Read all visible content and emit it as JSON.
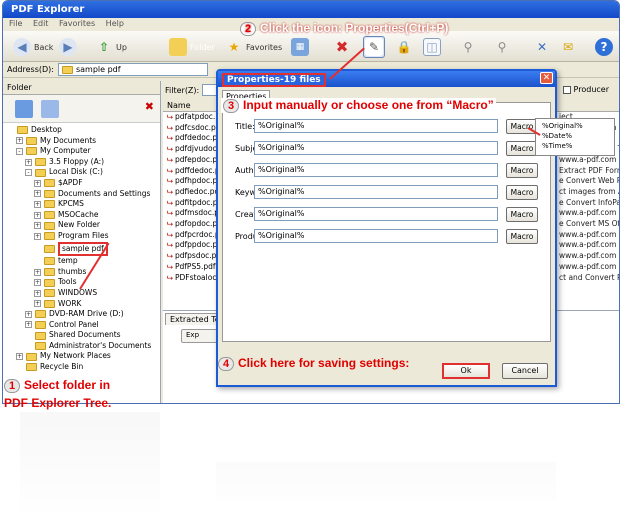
{
  "window": {
    "title": "PDF Explorer",
    "menu": [
      "File",
      "Edit",
      "Favorites",
      "Help"
    ]
  },
  "toolbar": {
    "back": "Back",
    "up": "Up",
    "folder": "Folder",
    "favorites": "Favorites"
  },
  "address": {
    "label": "Address(D):",
    "value": "sample pdf"
  },
  "left_pane": {
    "tab": "Folder",
    "tree": [
      {
        "label": "Desktop",
        "indent": 0,
        "expander": ""
      },
      {
        "label": "My Documents",
        "indent": 1,
        "expander": "+"
      },
      {
        "label": "My Computer",
        "indent": 1,
        "expander": "-"
      },
      {
        "label": "3.5 Floppy (A:)",
        "indent": 2,
        "expander": "+"
      },
      {
        "label": "Local Disk (C:)",
        "indent": 2,
        "expander": "-"
      },
      {
        "label": "$APDF",
        "indent": 3,
        "expander": "+"
      },
      {
        "label": "Documents and Settings",
        "indent": 3,
        "expander": "+"
      },
      {
        "label": "KPCMS",
        "indent": 3,
        "expander": "+"
      },
      {
        "label": "MSOCache",
        "indent": 3,
        "expander": "+"
      },
      {
        "label": "New Folder",
        "indent": 3,
        "expander": "+"
      },
      {
        "label": "Program Files",
        "indent": 3,
        "expander": "+"
      },
      {
        "label": "sample pdf",
        "indent": 3,
        "expander": "",
        "selected": true
      },
      {
        "label": "temp",
        "indent": 3,
        "expander": ""
      },
      {
        "label": "thumbs",
        "indent": 3,
        "expander": "+"
      },
      {
        "label": "Tools",
        "indent": 3,
        "expander": "+"
      },
      {
        "label": "WINDOWS",
        "indent": 3,
        "expander": "+"
      },
      {
        "label": "WORK",
        "indent": 3,
        "expander": "+"
      },
      {
        "label": "DVD-RAM Drive (D:)",
        "indent": 2,
        "expander": "+"
      },
      {
        "label": "Control Panel",
        "indent": 2,
        "expander": "+"
      },
      {
        "label": "Shared Documents",
        "indent": 2,
        "expander": ""
      },
      {
        "label": "Administrator's Documents",
        "indent": 2,
        "expander": ""
      },
      {
        "label": "My Network Places",
        "indent": 1,
        "expander": "+"
      },
      {
        "label": "Recycle Bin",
        "indent": 1,
        "expander": ""
      }
    ]
  },
  "list": {
    "filter_label": "Filter(Z):",
    "name_header": "Name",
    "producer_label": "Producer",
    "files": [
      "pdfatpdoc.pdf",
      "pdfcsdoc.pdf",
      "pdfdedoc.pdf",
      "pdfdjvudoc.pdf",
      "pdfepdoc.pdf",
      "pdffdedoc.pdf",
      "pdfhpdoc.pdf",
      "pdfiedoc.pdf",
      "pdfitpdoc.pdf",
      "pdfmsdoc.pdf",
      "pdfopdoc.pdf",
      "pdfpcrdoc.pdf",
      "pdfppdoc.pdf",
      "pdfpsdoc.pdf",
      "PdfPS5.pdf",
      "PDFstoaloc.pdf"
    ],
    "right_col": [
      "ject",
      "www.a-pdf.com",
      "e image from",
      "e Convert DjVu To",
      "www.a-pdf.com",
      "Extract PDF Form",
      "e Convert Web Pag",
      "ct images from Ac",
      "e Convert InfoPath",
      "www.a-pdf.com",
      "e Convert MS Offi",
      "www.a-pdf.com",
      "www.a-pdf.com",
      "www.a-pdf.com",
      "www.a-pdf.com",
      "ct and Convert PC"
    ],
    "bottom_tab": "Extracted Text",
    "bottom_button": "Exp"
  },
  "dialog": {
    "title": "Properties-19 files",
    "tab": "Properties",
    "fields": [
      {
        "label": "Title:",
        "value": "%Original%",
        "macro": "Macro"
      },
      {
        "label": "Subject",
        "value": "%Original%",
        "macro": "Macro"
      },
      {
        "label": "Author",
        "value": "%Original%",
        "macro": "Macro"
      },
      {
        "label": "Keywords",
        "value": "%Original%",
        "macro": "Macro"
      },
      {
        "label": "Creator",
        "value": "%Original%",
        "macro": "Macro"
      },
      {
        "label": "Producer",
        "value": "%Original%",
        "macro": "Macro"
      }
    ],
    "macro_options": [
      "%Original%",
      "%Date%",
      "%Time%"
    ],
    "ok": "Ok",
    "cancel": "Cancel"
  },
  "callouts": {
    "step1_num": "1",
    "step1_line1": "Select folder in",
    "step1_line2": "PDF Explorer Tree.",
    "step2_num": "2",
    "step2_text": "Click the icon: Properties(Ctrl+P)",
    "step3_num": "3",
    "step3_text": "Input manually or choose one from “Macro”",
    "step4_num": "4",
    "step4_text": "Click here for saving settings:"
  },
  "colors": {
    "callout_red": "#e00000",
    "title_blue": "#1a52cc"
  }
}
